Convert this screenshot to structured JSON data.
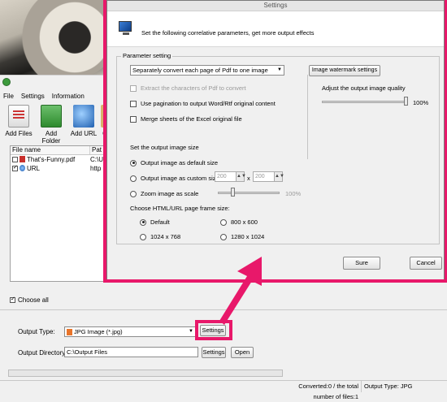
{
  "app": {
    "menu": [
      "File",
      "Settings",
      "Information"
    ],
    "toolbar": [
      {
        "label": "Add Files",
        "icon": "add-files-icon"
      },
      {
        "label": "Add Folder",
        "icon": "add-folder-icon"
      },
      {
        "label": "Add URL",
        "icon": "globe-icon"
      },
      {
        "label": "C",
        "icon": "partial-tool-icon"
      }
    ],
    "file_list": {
      "columns": [
        "File name",
        "Pat"
      ],
      "rows": [
        {
          "checked": false,
          "name": "That's-Funny.pdf",
          "path": "C:\\U"
        },
        {
          "checked": true,
          "name": "URL",
          "path": "http"
        }
      ]
    },
    "choose_all": {
      "label": "Choose all",
      "checked": true
    },
    "output_type": {
      "label": "Output Type:",
      "value": "JPG Image (*.jpg)",
      "settings_button": "Settings"
    },
    "output_directory": {
      "label": "Output Directory:",
      "value": "C:\\Output Files",
      "settings_button": "Settings",
      "open_button": "Open"
    },
    "progress": {
      "fraction": 0
    },
    "status": {
      "converted": "Converted:0  /  the total number of files:1",
      "output_type": "Output Type: JPG"
    }
  },
  "dialog": {
    "title": "Settings",
    "description": "Set the following correlative parameters, get more output effects",
    "group_label": "Parameter setting",
    "mode_select": "Separately convert each page of Pdf to one image",
    "watermark_button": "Image watermark settings",
    "quality_label": "Adjust the output image quality",
    "quality_value": "100%",
    "quality_fraction": 1.0,
    "checkboxes": [
      {
        "label": "Extract the characters of Pdf to convert",
        "checked": false,
        "disabled": true
      },
      {
        "label": "Use pagination to output Word/Rtf original content",
        "checked": false,
        "disabled": false
      },
      {
        "label": "Merge sheets of the Excel original file",
        "checked": false,
        "disabled": false
      }
    ],
    "size_heading": "Set the output image size",
    "size_options": [
      {
        "label": "Output image as default size",
        "selected": true
      },
      {
        "label": "Output image as custom size",
        "selected": false
      },
      {
        "label": "Zoom image as scale",
        "selected": false
      }
    ],
    "custom_width": "200",
    "custom_height": "200",
    "custom_sep": "x",
    "zoom_value": "100%",
    "frame_heading": "Choose HTML/URL page frame size:",
    "frame_options": [
      {
        "label": "Default",
        "selected": true
      },
      {
        "label": "800 x 600",
        "selected": false
      },
      {
        "label": "1024 x 768",
        "selected": false
      },
      {
        "label": "1280 x 1024",
        "selected": false
      }
    ],
    "ok_button": "Sure",
    "cancel_button": "Cancel"
  },
  "annotation": {
    "color": "#e8186a"
  }
}
